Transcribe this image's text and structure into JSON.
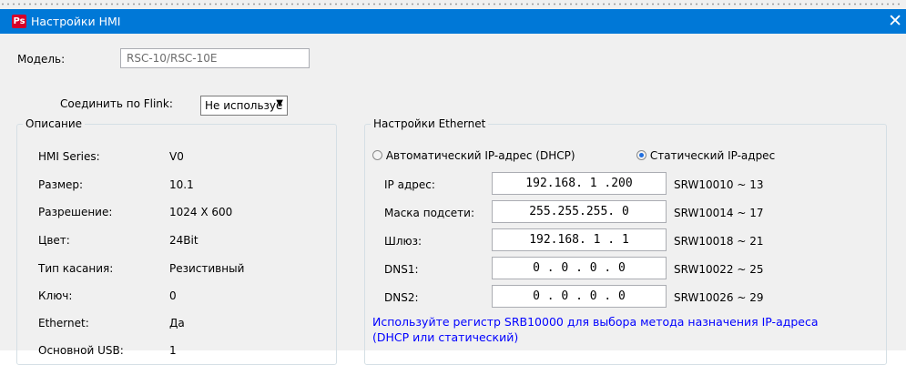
{
  "window": {
    "title": "Настройки HMI",
    "icon_text": "Ps",
    "close_glyph": "✕"
  },
  "model": {
    "label": "Модель:",
    "value": "RSC-10/RSC-10E"
  },
  "flink": {
    "label": "Соединить по Flink:",
    "selected": "Не используе"
  },
  "description": {
    "legend": "Описание",
    "rows": [
      {
        "label": "HMI Series:",
        "value": "V0"
      },
      {
        "label": "Размер:",
        "value": "10.1"
      },
      {
        "label": "Разрешение:",
        "value": "1024 X 600"
      },
      {
        "label": "Цвет:",
        "value": "24Bit"
      },
      {
        "label": "Тип касания:",
        "value": "Резистивный"
      },
      {
        "label": "Ключ:",
        "value": "0"
      },
      {
        "label": "Ethernet:",
        "value": "Да"
      },
      {
        "label": "Основной USB:",
        "value": "1"
      }
    ]
  },
  "ethernet": {
    "legend": "Настройки Ethernet",
    "dhcp_label": "Автоматический IP-адрес (DHCP)",
    "static_label": "Статический IP-адрес",
    "mode": "static",
    "rows": [
      {
        "label": "IP адрес:",
        "value": "192.168. 1 .200",
        "register": "SRW10010 ~ 13"
      },
      {
        "label": "Маска подсети:",
        "value": "255.255.255. 0",
        "register": "SRW10014 ~ 17"
      },
      {
        "label": "Шлюз:",
        "value": "192.168. 1 . 1",
        "register": "SRW10018 ~ 21"
      },
      {
        "label": "DNS1:",
        "value": "0 . 0 . 0 . 0",
        "register": "SRW10022 ~ 25"
      },
      {
        "label": "DNS2:",
        "value": "0 . 0 . 0 . 0",
        "register": "SRW10026 ~ 29"
      }
    ],
    "note_line1": "Используйте регистр SRB10000 для выбора метода назначения IP-адреса",
    "note_line2": "(DHCP или статический)"
  },
  "colors": {
    "titlebar": "#0078d7",
    "note": "#0000ff",
    "client": "#f0f0f0"
  }
}
